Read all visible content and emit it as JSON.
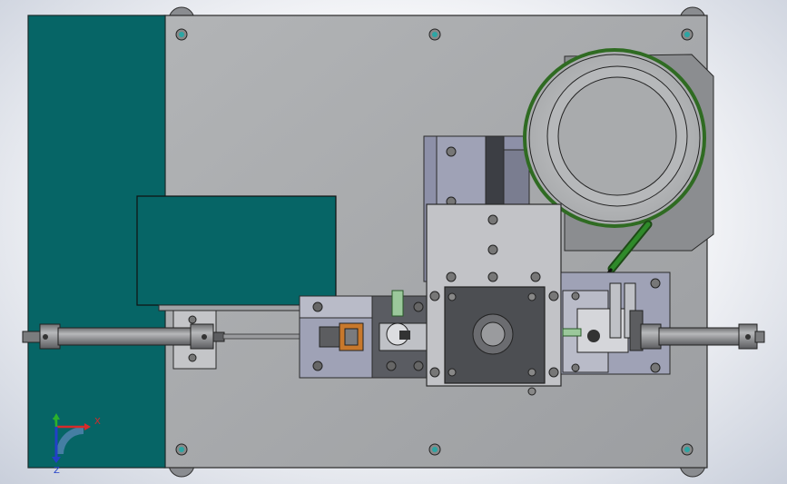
{
  "viewport": {
    "title": "",
    "background_color": "#eef0f4"
  },
  "colors": {
    "teal_panel": "#066566",
    "base_plate": "#a4a6a9",
    "plate_edge": "#2a2a2a",
    "cylinder_body": "#8e8f91",
    "green_feeder_ring": "#2f6b22",
    "fastener_cyan": "#2ca6a4",
    "block_dark": "#4c4e52",
    "bracket_light": "#c4c5c8",
    "bracket_blue": "#8d90a8",
    "accent_orange": "#c8782c"
  },
  "triad": {
    "x_label": "X",
    "y_label": "Y",
    "z_label": "Z",
    "x_color": "#d62a2a",
    "y_color": "#2bb12b",
    "z_color": "#2240c8"
  }
}
